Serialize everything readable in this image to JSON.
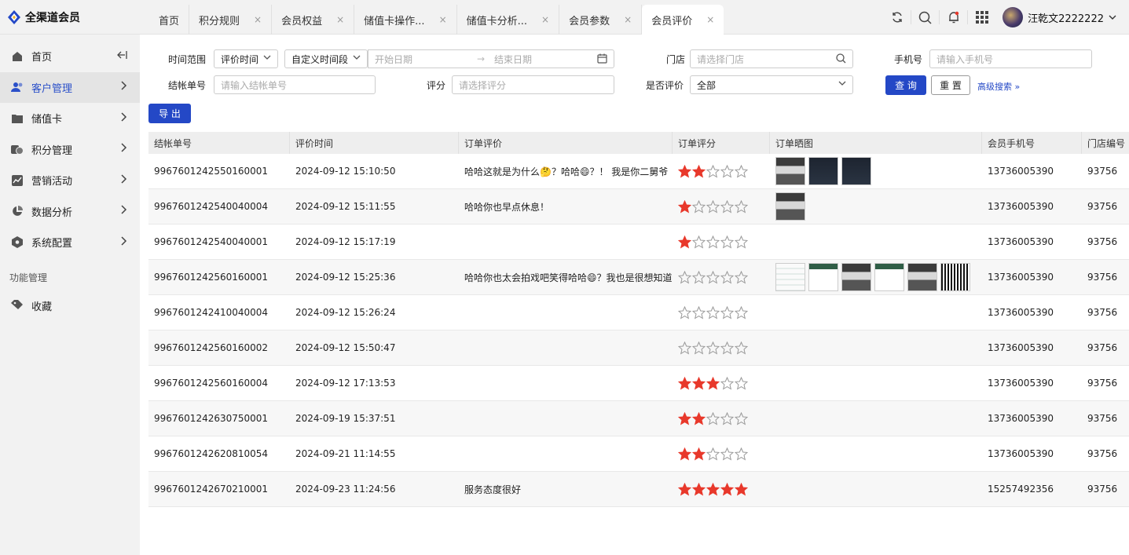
{
  "app": {
    "title": "全渠道会员"
  },
  "tabs": [
    {
      "label": "首页",
      "closable": false,
      "active": false
    },
    {
      "label": "积分规则",
      "closable": true,
      "active": false
    },
    {
      "label": "会员权益",
      "closable": true,
      "active": false
    },
    {
      "label": "储值卡操作...",
      "closable": true,
      "active": false
    },
    {
      "label": "储值卡分析...",
      "closable": true,
      "active": false
    },
    {
      "label": "会员参数",
      "closable": true,
      "active": false
    },
    {
      "label": "会员评价",
      "closable": true,
      "active": true
    }
  ],
  "tab_close_glyph": "×",
  "user": {
    "name": "汪乾文2222222"
  },
  "sidebar": {
    "items": [
      {
        "label": "首页",
        "icon": "home-icon"
      },
      {
        "label": "客户管理",
        "icon": "users-icon"
      },
      {
        "label": "储值卡",
        "icon": "card-icon"
      },
      {
        "label": "积分管理",
        "icon": "coins-icon"
      },
      {
        "label": "营销活动",
        "icon": "chart-line-icon"
      },
      {
        "label": "数据分析",
        "icon": "pie-icon"
      },
      {
        "label": "系统配置",
        "icon": "hexagon-icon"
      }
    ],
    "section_label": "功能管理",
    "favorites_label": "收藏"
  },
  "filters": {
    "time_range_label": "时间范围",
    "time_type": "评价时间",
    "time_mode": "自定义时间段",
    "start_placeholder": "开始日期",
    "end_placeholder": "结束日期",
    "date_sep": "→",
    "store_label": "门店",
    "store_placeholder": "请选择门店",
    "phone_label": "手机号",
    "phone_placeholder": "请输入手机号",
    "order_label": "结帐单号",
    "order_placeholder": "请输入结帐单号",
    "score_label": "评分",
    "score_placeholder": "请选择评分",
    "rated_label": "是否评价",
    "rated_value": "全部",
    "query_label": "查 询",
    "reset_label": "重 置",
    "advanced_label": "高级搜索 »",
    "export_label": "导 出"
  },
  "table": {
    "columns": [
      "结帐单号",
      "评价时间",
      "订单评价",
      "订单评分",
      "订单晒图",
      "会员手机号",
      "门店编号"
    ],
    "rows": [
      {
        "order": "9967601242550160001",
        "time": "2024-09-12 15:10:50",
        "comment": "哈哈这就是为什么🤔？哈哈😄？！ 我是你二舅爷",
        "score": 2,
        "images": [
          "grey",
          "dark",
          "dark"
        ],
        "phone": "13736005390",
        "store": "93756"
      },
      {
        "order": "9967601242540040004",
        "time": "2024-09-12 15:11:55",
        "comment": "哈哈你也早点休息！",
        "score": 1,
        "images": [
          "grey"
        ],
        "phone": "13736005390",
        "store": "93756"
      },
      {
        "order": "9967601242540040001",
        "time": "2024-09-12 15:17:19",
        "comment": "",
        "score": 1,
        "images": [],
        "phone": "13736005390",
        "store": "93756"
      },
      {
        "order": "9967601242560160001",
        "time": "2024-09-12 15:25:36",
        "comment": "哈哈你也太会拍戏吧笑得哈哈😄？我也是很想知道",
        "score": 0,
        "images": [
          "light",
          "green",
          "grey",
          "green",
          "grey",
          "qr"
        ],
        "phone": "13736005390",
        "store": "93756"
      },
      {
        "order": "9967601242410040004",
        "time": "2024-09-12 15:26:24",
        "comment": "",
        "score": 0,
        "images": [],
        "phone": "13736005390",
        "store": "93756"
      },
      {
        "order": "9967601242560160002",
        "time": "2024-09-12 15:50:47",
        "comment": "",
        "score": 0,
        "images": [],
        "phone": "13736005390",
        "store": "93756"
      },
      {
        "order": "9967601242560160004",
        "time": "2024-09-12 17:13:53",
        "comment": "",
        "score": 3,
        "images": [],
        "phone": "13736005390",
        "store": "93756"
      },
      {
        "order": "9967601242630750001",
        "time": "2024-09-19 15:37:51",
        "comment": "",
        "score": 2,
        "images": [],
        "phone": "13736005390",
        "store": "93756"
      },
      {
        "order": "9967601242620810054",
        "time": "2024-09-21 11:14:55",
        "comment": "",
        "score": 2,
        "images": [],
        "phone": "13736005390",
        "store": "93756"
      },
      {
        "order": "9967601242670210001",
        "time": "2024-09-23 11:24:56",
        "comment": "服务态度很好",
        "score": 5,
        "images": [],
        "phone": "15257492356",
        "store": "93756"
      }
    ]
  },
  "colors": {
    "primary": "#2448c6",
    "star": "#e8382b",
    "active_nav": "#2b50c9"
  }
}
